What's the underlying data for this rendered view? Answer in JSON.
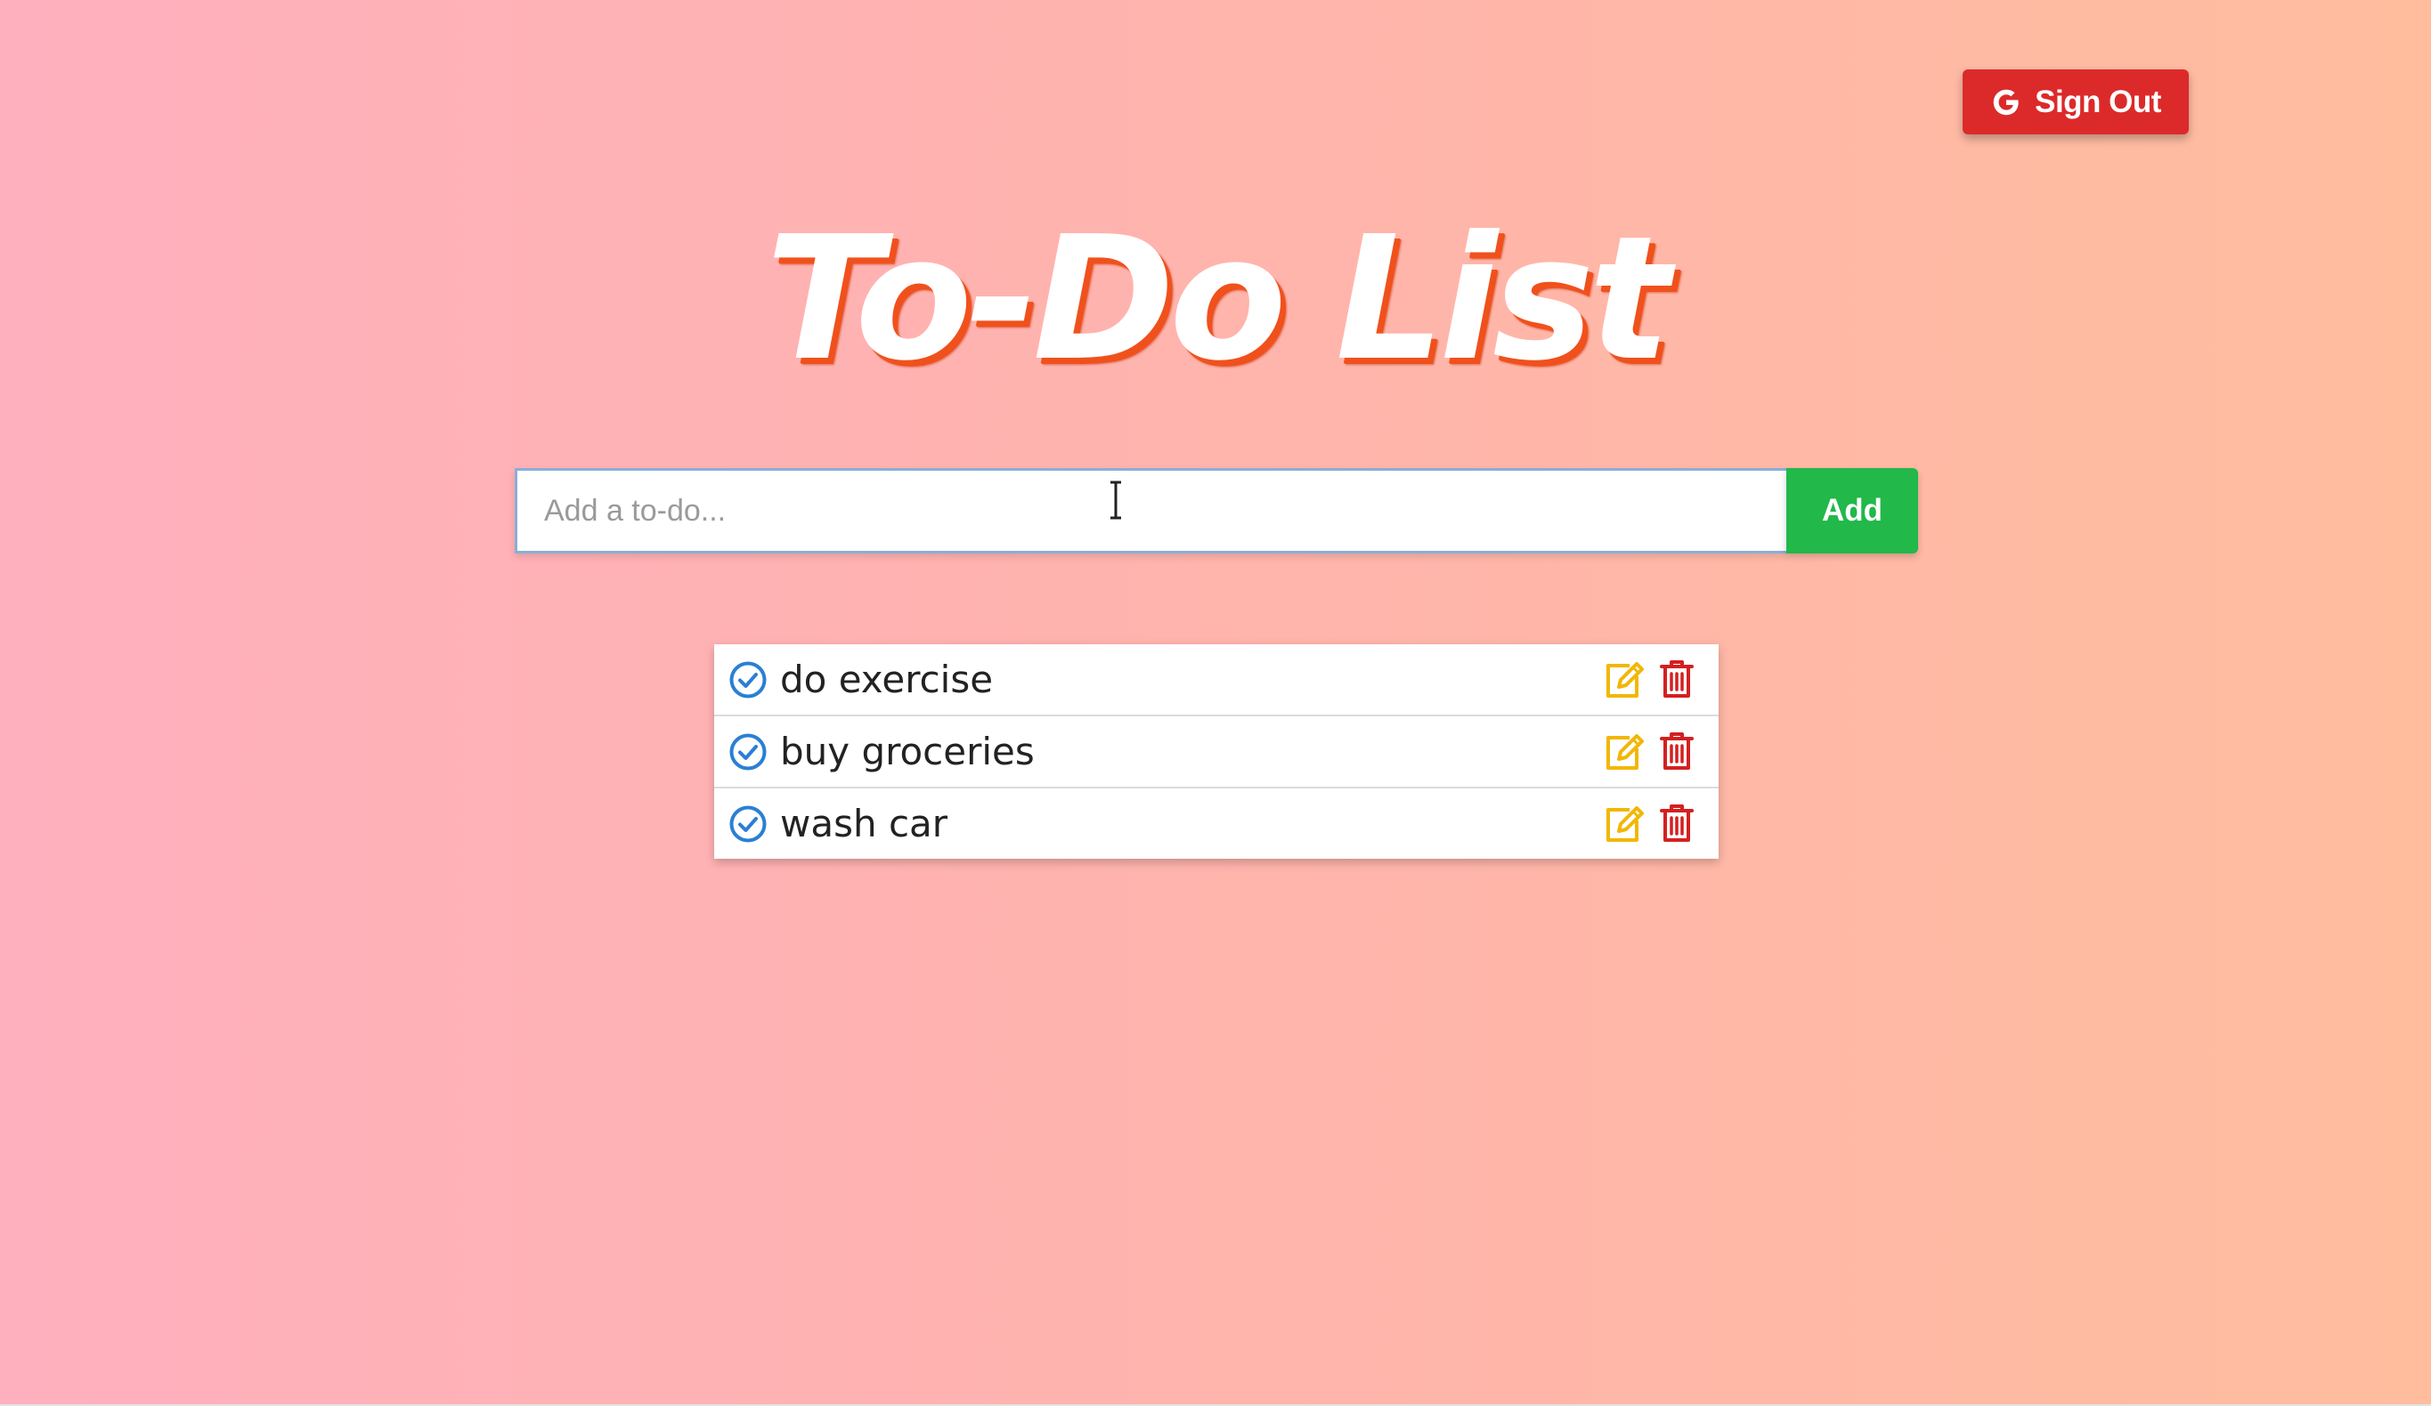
{
  "header": {
    "sign_out_label": "Sign Out",
    "sign_out_icon": "google-icon"
  },
  "title": "To-Do List",
  "add_form": {
    "input_placeholder": "Add a to-do...",
    "input_value": "",
    "add_label": "Add"
  },
  "todos": [
    {
      "text": "do exercise"
    },
    {
      "text": "buy groceries"
    },
    {
      "text": "wash car"
    }
  ],
  "icons": {
    "check": "check-circle-icon",
    "edit": "edit-icon",
    "delete": "trash-icon"
  },
  "colors": {
    "sign_out_bg": "#dc2a2a",
    "add_bg": "#22b84a",
    "title_shadow": "#f0511c",
    "check": "#2a7fd4",
    "edit": "#f2b705",
    "delete": "#d42020"
  }
}
